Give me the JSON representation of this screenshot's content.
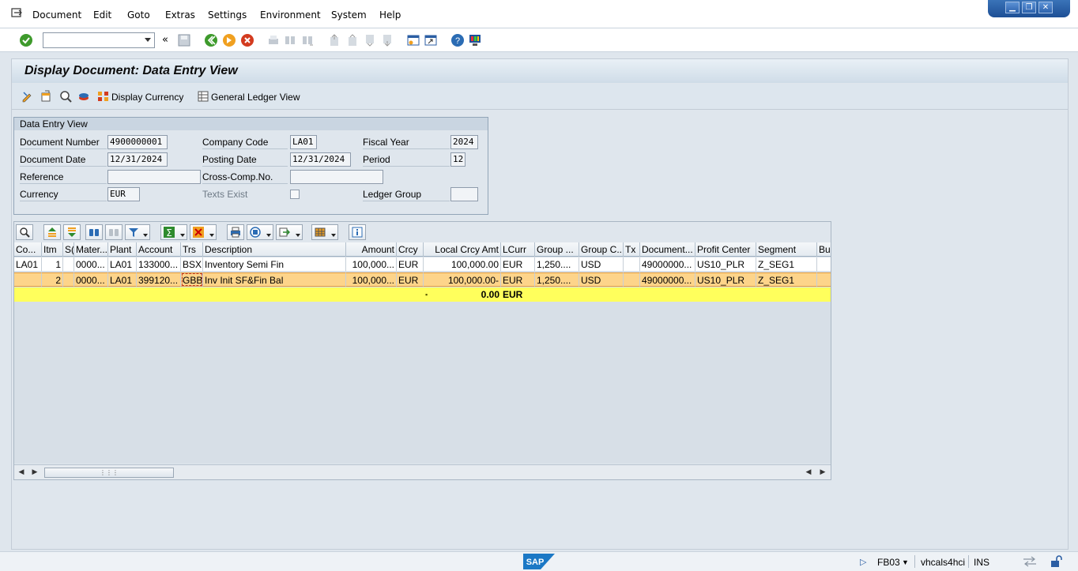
{
  "menubar": {
    "items": [
      "Document",
      "Edit",
      "Goto",
      "Extras",
      "Settings",
      "Environment",
      "System",
      "Help"
    ]
  },
  "window_buttons": {
    "minimize": "▁",
    "restore": "❐",
    "close": "✕"
  },
  "toolbar": {
    "command_field_value": "",
    "icons": [
      "enter-icon",
      "back-icon",
      "save-icon",
      "back-green-icon",
      "exit-icon",
      "cancel-icon",
      "print-icon",
      "find-icon",
      "find-next-icon",
      "first-page-icon",
      "prev-page-icon",
      "next-page-icon",
      "last-page-icon",
      "create-session-icon",
      "shortcut-icon",
      "help-icon",
      "customize-icon"
    ]
  },
  "page": {
    "title": "Display Document: Data Entry View"
  },
  "app_toolbar": {
    "display_currency_label": "Display Currency",
    "general_ledger_view_label": "General Ledger View"
  },
  "data_entry_view": {
    "title": "Data Entry View",
    "document_number": {
      "label": "Document Number",
      "value": "4900000001"
    },
    "company_code": {
      "label": "Company Code",
      "value": "LA01"
    },
    "fiscal_year": {
      "label": "Fiscal Year",
      "value": "2024"
    },
    "document_date": {
      "label": "Document Date",
      "value": "12/31/2024"
    },
    "posting_date": {
      "label": "Posting Date",
      "value": "12/31/2024"
    },
    "period": {
      "label": "Period",
      "value": "12"
    },
    "reference": {
      "label": "Reference",
      "value": ""
    },
    "cross_comp": {
      "label": "Cross-Comp.No.",
      "value": ""
    },
    "currency": {
      "label": "Currency",
      "value": "EUR"
    },
    "texts_exist": {
      "label": "Texts Exist",
      "checked": false
    },
    "ledger_group": {
      "label": "Ledger Group",
      "value": ""
    }
  },
  "grid": {
    "headers": [
      "Co...",
      "Itm",
      "S(",
      "Mater...",
      "Plant",
      "Account",
      "Trs",
      "Description",
      "Amount",
      "Crcy",
      "Local Crcy Amt",
      "LCurr",
      "Group ...",
      "Group C...",
      "Tx",
      "Document...",
      "Profit Center",
      "Segment",
      "Bus"
    ],
    "rows": [
      [
        "LA01",
        "1",
        "",
        "0000...",
        "LA01",
        "133000...",
        "BSX",
        "Inventory Semi Fin",
        "100,000...",
        "EUR",
        "100,000.00",
        "EUR",
        "1,250....",
        "USD",
        "",
        "49000000...",
        "US10_PLR",
        "Z_SEG1",
        ""
      ],
      [
        "",
        "2",
        "",
        "0000...",
        "LA01",
        "399120...",
        "GBB",
        "Inv Init SF&Fin Bal",
        "100,000...",
        "EUR",
        "100,000.00-",
        "EUR",
        "1,250....",
        "USD",
        "",
        "49000000...",
        "US10_PLR",
        "Z_SEG1",
        ""
      ]
    ],
    "total": {
      "marker": "▪",
      "amount": "0.00",
      "currency": "EUR"
    }
  },
  "statusbar": {
    "transaction": "FB03",
    "system": "vhcals4hci",
    "mode": "INS",
    "logo_text": "SAP"
  },
  "colors": {
    "selected_row": "#fdd48a",
    "total_row": "#ffff5c",
    "title_bg": "#cfdce8"
  }
}
